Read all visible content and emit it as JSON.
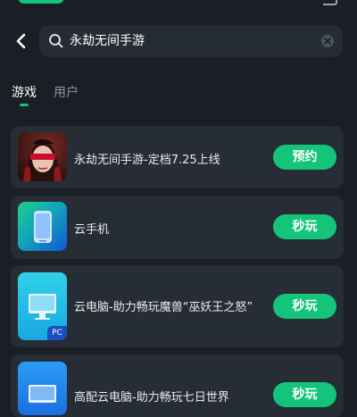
{
  "colors": {
    "accent": "#13c47a",
    "background": "#1a1f25",
    "card": "#262d34"
  },
  "search": {
    "query": "永劫无间手游"
  },
  "tabs": [
    {
      "label": "游戏",
      "active": true
    },
    {
      "label": "用户",
      "active": false
    }
  ],
  "results": [
    {
      "title": "永劫无间手游-定档7.25上线",
      "action": "预约",
      "icon": "game-warrior-icon"
    },
    {
      "title": "云手机",
      "action": "秒玩",
      "icon": "cloud-phone-icon"
    },
    {
      "title": "云电脑-助力畅玩魔兽“巫妖王之怒”",
      "action": "秒玩",
      "icon": "cloud-pc-icon",
      "badge": "PC"
    },
    {
      "title": "高配云电脑-助力畅玩七日世界",
      "action": "秒玩",
      "icon": "cloud-pc-icon"
    }
  ]
}
